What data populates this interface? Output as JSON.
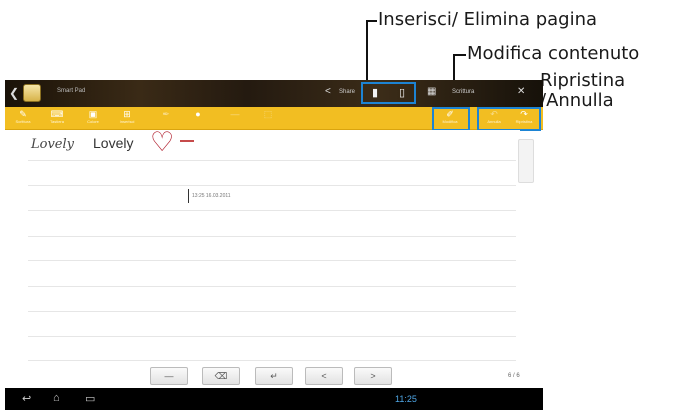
{
  "annotations": {
    "insert_delete_page": "Inserisci/ Elimina pagina",
    "edit_content": "Modifica contenuto",
    "redo_undo_line1": "Ripristina",
    "redo_undo_line2": "/Annulla"
  },
  "titlebar": {
    "back_icon": "chevron-left-icon",
    "app_icon": "notebook-icon",
    "title": "Smart Pad",
    "share_label": "Share",
    "mode_label": "Scrittura",
    "buttons": [
      "insert-page-icon",
      "delete-page-icon",
      "grid-icon",
      "more-icon"
    ]
  },
  "toolbar": {
    "tools": [
      {
        "icon": "pen-icon",
        "label": "Scrittura"
      },
      {
        "icon": "keyboard-icon",
        "label": "Tastiera"
      },
      {
        "icon": "palette-icon",
        "label": "Colore"
      },
      {
        "icon": "insert-icon",
        "label": "Inserisci"
      },
      {
        "icon": "brush-icon",
        "label": ""
      },
      {
        "icon": "stroke-icon",
        "label": ""
      },
      {
        "icon": "eraser-icon",
        "label": ""
      },
      {
        "icon": "select-icon",
        "label": ""
      }
    ],
    "edit_label": "Modifica",
    "undo_label": "Annulla",
    "redo_label": "Ripristina"
  },
  "page": {
    "handwriting": "Lovely",
    "typed_text": "Lovely",
    "timestamp": "13:25 16.03.2011"
  },
  "keys": {
    "space": "—",
    "backspace": "⌫",
    "enter": "↵",
    "prev": "<",
    "next": ">"
  },
  "page_count": "6 / 6",
  "status_time": "11:25"
}
